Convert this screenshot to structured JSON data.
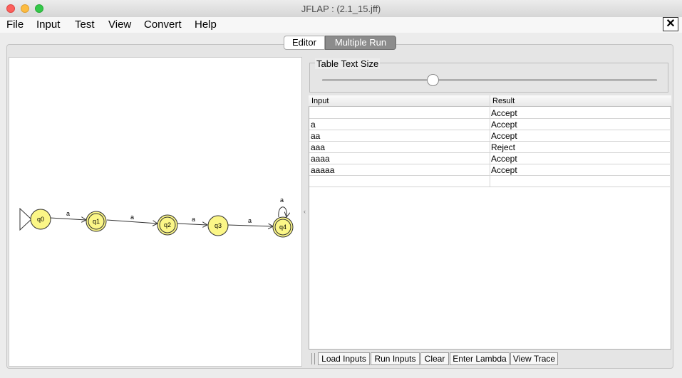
{
  "window": {
    "title": "JFLAP : (2.1_15.jff)"
  },
  "menu": [
    "File",
    "Input",
    "Test",
    "View",
    "Convert",
    "Help"
  ],
  "close_symbol": "✕",
  "tabs": {
    "editor": "Editor",
    "multiple_run": "Multiple Run"
  },
  "automaton": {
    "states": [
      "q0",
      "q1",
      "q2",
      "q3",
      "q4"
    ],
    "initial": "q0",
    "final": [
      "q1",
      "q2",
      "q4"
    ],
    "transitions": [
      {
        "from": "q0",
        "to": "q1",
        "label": "a"
      },
      {
        "from": "q1",
        "to": "q2",
        "label": "a"
      },
      {
        "from": "q2",
        "to": "q3",
        "label": "a"
      },
      {
        "from": "q3",
        "to": "q4",
        "label": "a"
      },
      {
        "from": "q4",
        "to": "q4",
        "label": "a"
      }
    ],
    "state_color": "#fbf687"
  },
  "table_text_size": {
    "label": "Table Text Size",
    "slider_value": 0.33
  },
  "table": {
    "headers": {
      "input": "Input",
      "result": "Result"
    },
    "rows": [
      {
        "input": "",
        "result": "Accept"
      },
      {
        "input": "a",
        "result": "Accept"
      },
      {
        "input": "aa",
        "result": "Accept"
      },
      {
        "input": "aaa",
        "result": "Reject"
      },
      {
        "input": "aaaa",
        "result": "Accept"
      },
      {
        "input": "aaaaa",
        "result": "Accept"
      },
      {
        "input": "",
        "result": ""
      }
    ]
  },
  "buttons": {
    "load_inputs": "Load Inputs",
    "run_inputs": "Run Inputs",
    "clear": "Clear",
    "enter_lambda": "Enter Lambda",
    "view_trace": "View Trace"
  },
  "divider_arrow": "‹"
}
